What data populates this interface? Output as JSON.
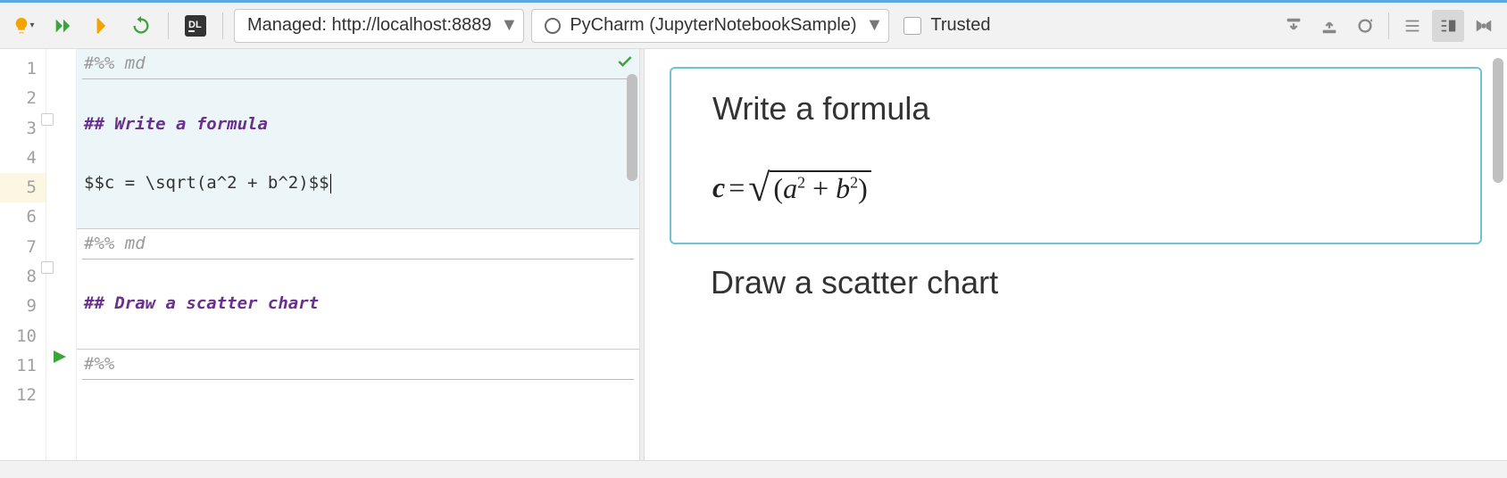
{
  "toolbar": {
    "server_label": "Managed: http://localhost:8889",
    "kernel_label": "PyCharm (JupyterNotebookSample)",
    "trusted_label": "Trusted"
  },
  "editor": {
    "lines": [
      "1",
      "2",
      "3",
      "4",
      "5",
      "6",
      "7",
      "8",
      "9",
      "10",
      "11",
      "12"
    ],
    "cell1": {
      "marker": "#%% md",
      "heading": "## Write a formula",
      "formula": "$$c = \\sqrt(a^2 + b^2)$$"
    },
    "cell2": {
      "marker": "#%% md",
      "heading": "## Draw a scatter chart"
    },
    "cell3": {
      "marker": "#%%"
    }
  },
  "preview": {
    "cell1_heading": "Write a formula",
    "cell1_formula_c": "c",
    "cell1_formula_eq": " = ",
    "cell1_formula_a": "a",
    "cell1_formula_plus": " + ",
    "cell1_formula_b": "b",
    "cell1_formula_lp": "(",
    "cell1_formula_rp": ")",
    "cell1_formula_sq2a": "2",
    "cell1_formula_sq2b": "2",
    "cell2_heading": "Draw a scatter chart"
  }
}
